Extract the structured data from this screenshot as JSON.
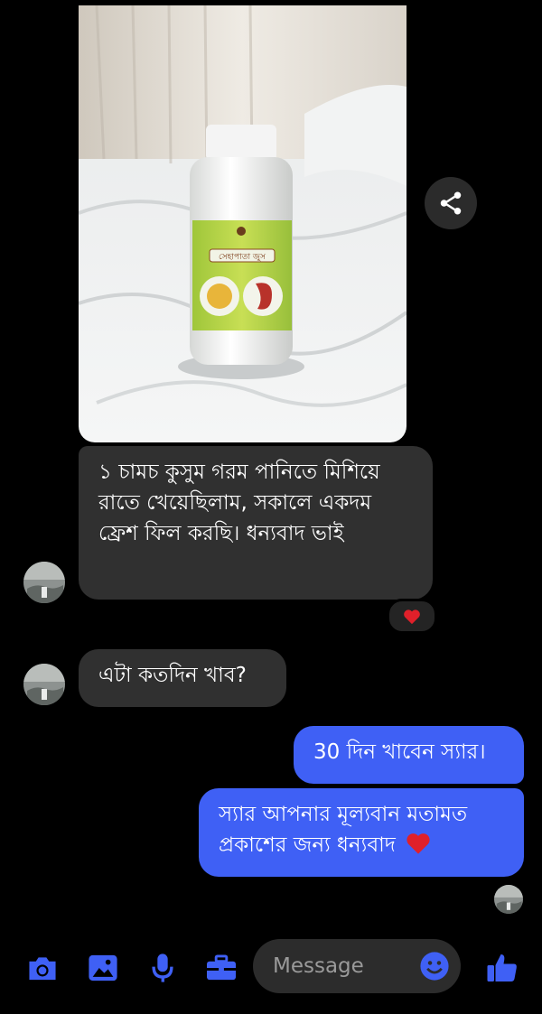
{
  "messages": {
    "photo": {
      "icon": "product-bottle-photo",
      "bottle_label": "সেহাপাতা জুস",
      "share_icon": "share-icon"
    },
    "incoming": [
      {
        "text": "১ চামচ কুসুম গরম পানিতে মিশিয়ে রাতে খেয়েছিলাম, সকালে একদম ফ্রেশ ফিল করছি। ধন্যবাদ ভাই",
        "reaction": "heart"
      },
      {
        "text": "এটা কতদিন খাব?"
      }
    ],
    "outgoing": [
      {
        "text": "30 দিন খাবেন স্যার।"
      },
      {
        "text": "স্যার আপনার মূল্যবান মতামত প্রকাশের জন্য ধন্যবাদ",
        "emoji": "heart"
      }
    ]
  },
  "composer": {
    "placeholder": "Message",
    "icons": [
      "camera-icon",
      "gallery-icon",
      "microphone-icon",
      "briefcase-icon",
      "emoji-icon",
      "thumbs-up-icon"
    ]
  },
  "colors": {
    "accent": "#3f60f5",
    "incoming_bubble": "#303030",
    "heart": "#e0202a"
  }
}
